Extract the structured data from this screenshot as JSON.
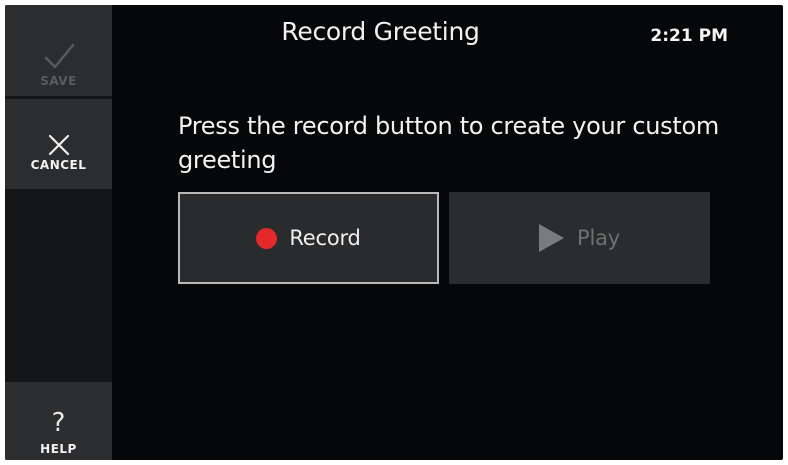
{
  "header": {
    "title": "Record Greeting",
    "time": "2:21 PM"
  },
  "sidebar": {
    "save": {
      "label": "SAVE",
      "icon": "checkmark-icon",
      "enabled": false
    },
    "cancel": {
      "label": "CANCEL",
      "icon": "close-icon",
      "enabled": true
    },
    "help": {
      "label": "HELP",
      "icon": "question-icon",
      "glyph": "?",
      "enabled": true
    }
  },
  "main": {
    "instruction": "Press the record button to create your custom greeting",
    "record_button": {
      "label": "Record",
      "icon": "record-dot-icon",
      "icon_color": "#e5282c"
    },
    "play_button": {
      "label": "Play",
      "icon": "play-icon",
      "enabled": false
    }
  },
  "colors": {
    "background": "#060708",
    "sidebar": "#141516",
    "button": "#2c2d2e",
    "record_red": "#e5282c",
    "disabled_text": "#6f7071"
  }
}
